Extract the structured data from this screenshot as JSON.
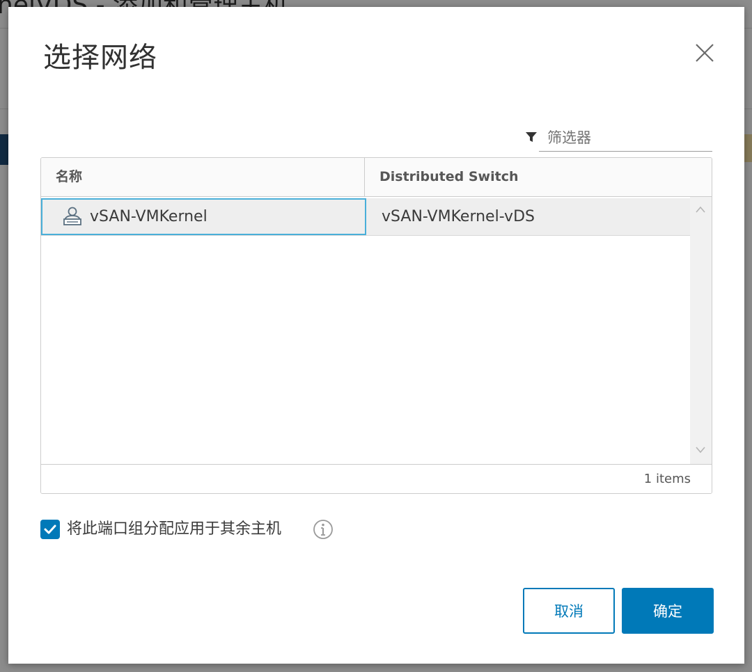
{
  "background": {
    "title_fragment": "nelVDS - 添加和管理主机"
  },
  "dialog": {
    "title": "选择网络",
    "close_icon": "close-icon"
  },
  "filter": {
    "placeholder": "筛选器",
    "value": "",
    "icon": "filter-icon"
  },
  "grid": {
    "columns": [
      "名称",
      "Distributed Switch"
    ],
    "rows": [
      {
        "name": "vSAN-VMKernel",
        "switch": "vSAN-VMKernel-vDS",
        "icon": "distributed-portgroup-icon",
        "selected": true
      }
    ],
    "footer": "1 items"
  },
  "apply_option": {
    "label": "将此端口组分配应用于其余主机",
    "checked": true,
    "info_icon": "info-icon"
  },
  "buttons": {
    "cancel": "取消",
    "ok": "确定"
  },
  "colors": {
    "primary": "#0079b8",
    "selection_border": "#49afd9",
    "row_background": "#eeeeee"
  }
}
